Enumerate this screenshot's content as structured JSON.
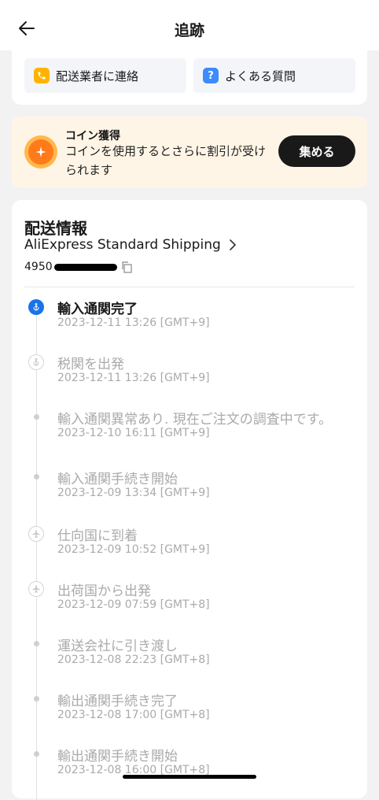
{
  "header": {
    "title": "追跡"
  },
  "contact": {
    "carrier_label": "配送業者に連絡",
    "faq_label": "よくある質問",
    "faq_icon_glyph": "?"
  },
  "coin": {
    "title": "コイン獲得",
    "description": "コインを使用するとさらに割引が受けられます",
    "button_label": "集める"
  },
  "shipping": {
    "title": "配送情報",
    "method": "AliExpress Standard Shipping",
    "tracking_prefix": "4950",
    "events": [
      {
        "title": "輸入通関完了",
        "time": "2023-12-11 13:26 [GMT+9]",
        "marker": "active"
      },
      {
        "title": "税関を出発",
        "time": "2023-12-11 13:26 [GMT+9]",
        "marker": "customs-icon"
      },
      {
        "title": "輸入通関異常あり. 現在ご注文の調査中です。",
        "time": "2023-12-10 16:11 [GMT+9]",
        "marker": "dot"
      },
      {
        "title": "輸入通関手続き開始",
        "time": "2023-12-09 13:34 [GMT+9]",
        "marker": "dot"
      },
      {
        "title": "仕向国に到着",
        "time": "2023-12-09 10:52 [GMT+9]",
        "marker": "plane-icon"
      },
      {
        "title": "出荷国から出発",
        "time": "2023-12-09 07:59 [GMT+8]",
        "marker": "plane-icon"
      },
      {
        "title": "運送会社に引き渡し",
        "time": "2023-12-08 22:23 [GMT+8]",
        "marker": "dot"
      },
      {
        "title": "輸出通関手続き完了",
        "time": "2023-12-08 17:00 [GMT+8]",
        "marker": "dot"
      },
      {
        "title": "輸出通関手続き開始",
        "time": "2023-12-08 16:00 [GMT+8]",
        "marker": "dot"
      }
    ]
  },
  "colors": {
    "active_blue": "#1a73e8",
    "phone_orange": "#ffb300",
    "faq_blue": "#3d8bfd",
    "coin_bg": "#fff5e6"
  }
}
